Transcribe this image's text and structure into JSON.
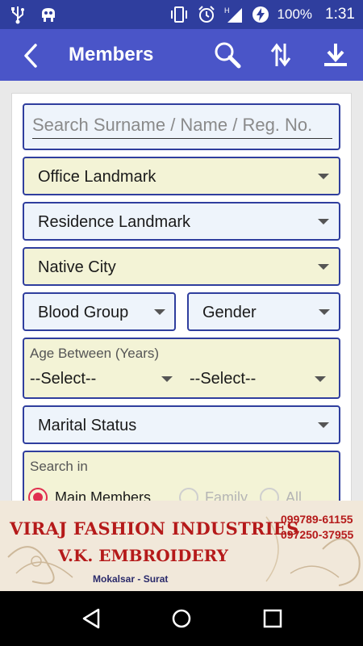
{
  "status_bar": {
    "battery": "100%",
    "time": "1:31",
    "network": "H"
  },
  "app_bar": {
    "title": "Members",
    "icons": [
      "back-arrow-icon",
      "search-icon",
      "sort-icon",
      "download-icon"
    ]
  },
  "form": {
    "search_placeholder": "Search Surname / Name / Reg. No.",
    "office_landmark": "Office Landmark",
    "residence_landmark": "Residence Landmark",
    "native_city": "Native City",
    "blood_group": "Blood Group",
    "gender": "Gender",
    "age_between_label": "Age Between (Years)",
    "age_from": "--Select--",
    "age_to": "--Select--",
    "marital_status": "Marital Status",
    "search_in_label": "Search in",
    "search_in_options": [
      "Main Members",
      "Family",
      "All"
    ],
    "search_in_selected": "Main Members"
  },
  "ad": {
    "line1": "VIRAJ FASHION INDUSTRIES",
    "line2": "V.K. EMBROIDERY",
    "line3": "Mokalsar - Surat",
    "phone1": "099789-61155",
    "phone2": "097250-37955"
  },
  "colors": {
    "status_bar": "#2f3e9e",
    "app_bar": "#4a55c8",
    "field_border": "#2f3e9e",
    "field_blue_bg": "#eef4fb",
    "field_yellow_bg": "#f3f3d6",
    "radio_selected": "#e02f4f"
  }
}
